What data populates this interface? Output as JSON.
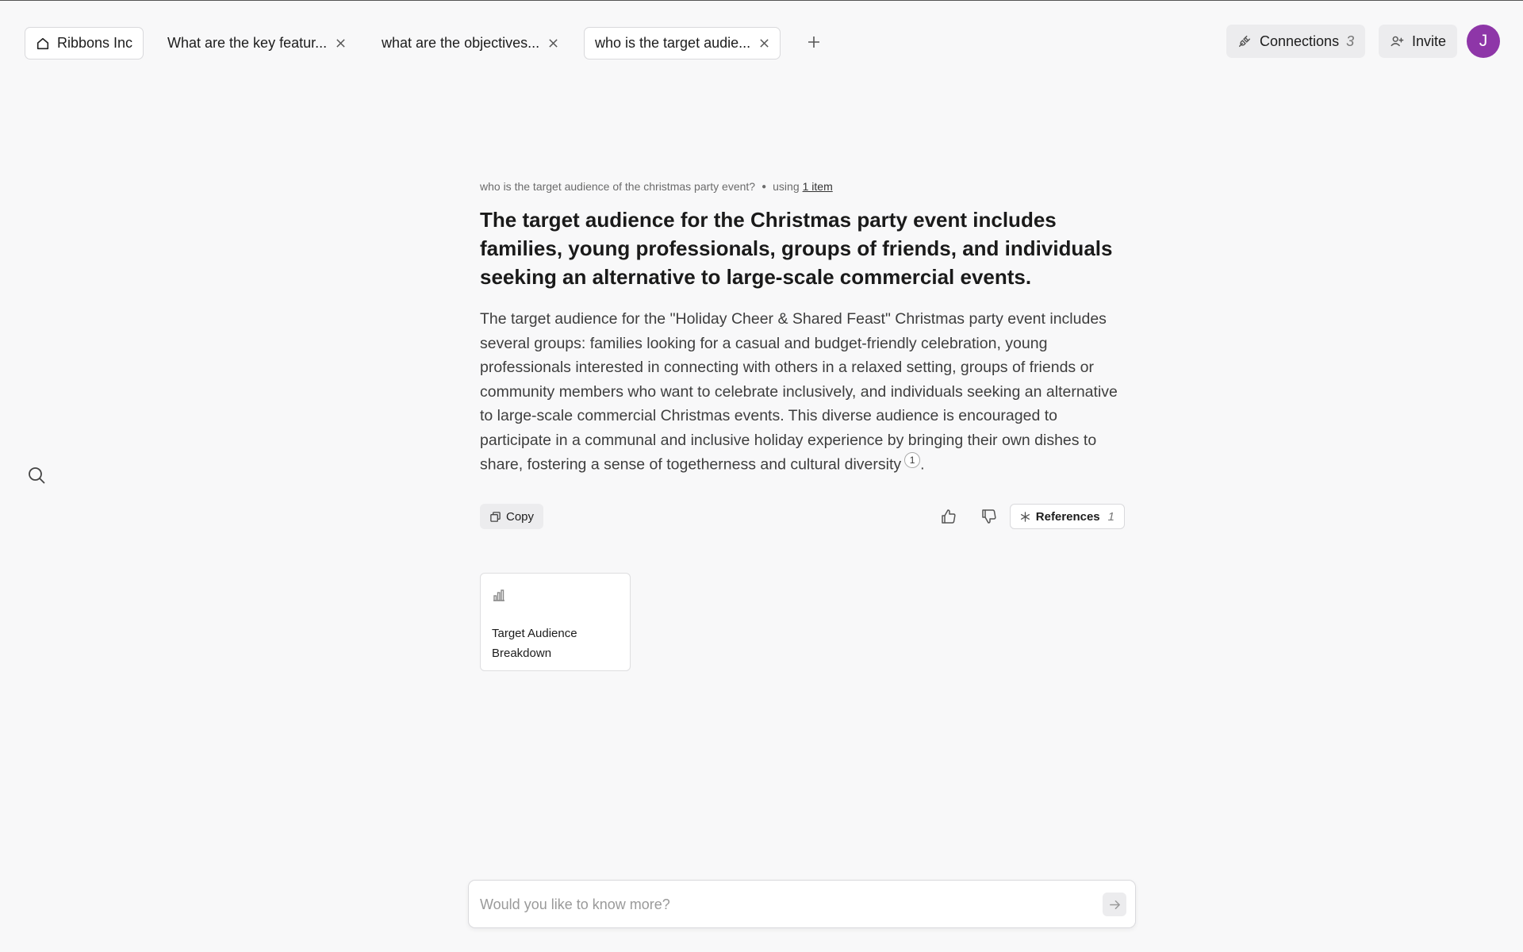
{
  "tabs": {
    "home_label": "Ribbons Inc",
    "items": [
      {
        "label": "What are the key featur..."
      },
      {
        "label": "what are the objectives..."
      },
      {
        "label": "who is the target audie..."
      }
    ]
  },
  "header": {
    "connections_label": "Connections",
    "connections_count": "3",
    "invite_label": "Invite",
    "avatar_initial": "J"
  },
  "answer": {
    "question": "who is the target audience of the christmas party event?",
    "using_label": "using",
    "using_link": "1 item",
    "headline": "The target audience for the Christmas party event includes families, young professionals, groups of friends, and individuals seeking an alternative to large-scale commercial events.",
    "body": "The target audience for the \"Holiday Cheer & Shared Feast\" Christmas party event includes several groups: families looking for a casual and budget-friendly celebration, young professionals interested in connecting with others in a relaxed setting, groups of friends or community members who want to celebrate inclusively, and individuals seeking an alternative to large-scale commercial Christmas events. This diverse audience is encouraged to participate in a communal and inclusive holiday experience by bringing their own dishes to share, fostering a sense of togetherness and cultural diversity",
    "citation": "1",
    "body_end": "."
  },
  "actions": {
    "copy_label": "Copy",
    "references_label": "References",
    "references_count": "1"
  },
  "reference_card": {
    "title": "Target Audience Breakdown"
  },
  "composer": {
    "placeholder": "Would you like to know more?"
  },
  "icons": {
    "home": "home-icon",
    "close": "close-icon",
    "plus": "plus-icon",
    "connections": "plug-icon",
    "invite": "user-plus-icon",
    "search": "search-icon",
    "copy": "copy-icon",
    "thumbs_up": "thumbs-up-icon",
    "thumbs_down": "thumbs-down-icon",
    "references": "asterisk-icon",
    "chart": "bar-chart-icon",
    "send": "arrow-right-icon"
  },
  "colors": {
    "avatar": "#8e36a8",
    "background": "#f8f8f9"
  }
}
